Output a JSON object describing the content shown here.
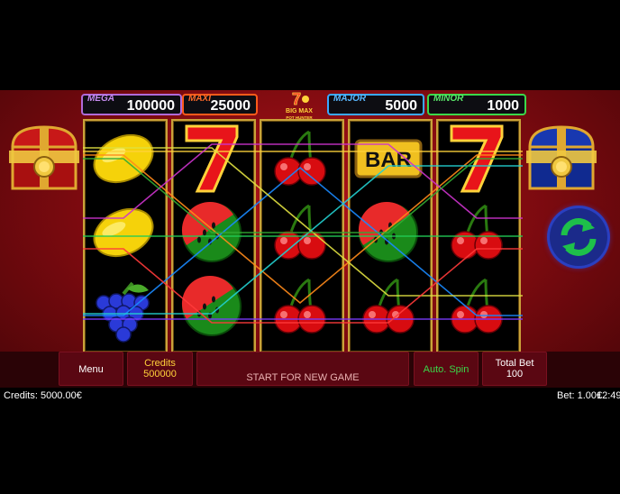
{
  "jackpots": {
    "mega": {
      "label": "MEGA",
      "value": "100000"
    },
    "maxi": {
      "label": "MAXI",
      "value": "25000"
    },
    "major": {
      "label": "MAJOR",
      "value": "5000"
    },
    "minor": {
      "label": "MINOR",
      "value": "1000"
    }
  },
  "logo": {
    "line1": "BIG MAX",
    "line2": "POT HUNTER"
  },
  "reels": [
    [
      "lemon",
      "lemon",
      "grapes"
    ],
    [
      "seven",
      "watermelon",
      "watermelon"
    ],
    [
      "cherry",
      "cherry",
      "cherry"
    ],
    [
      "bar",
      "watermelon",
      "cherry"
    ],
    [
      "seven",
      "cherry",
      "cherry"
    ]
  ],
  "bar_symbol_text": "BAR",
  "paylines": [
    {
      "color": "#ffd23a"
    },
    {
      "color": "#22cc55"
    },
    {
      "color": "#7a3aff"
    },
    {
      "color": "#ff8a1a"
    },
    {
      "color": "#1a8aff"
    },
    {
      "color": "#e0e040"
    },
    {
      "color": "#22d0d0"
    },
    {
      "color": "#cc33cc"
    },
    {
      "color": "#ff3a3a"
    },
    {
      "color": "#33aa33"
    }
  ],
  "controls": {
    "menu": "Menu",
    "credits_label": "Credits",
    "credits_value": "500000",
    "message": "START FOR NEW GAME",
    "auto_spin": "Auto. Spin",
    "total_bet_label": "Total Bet",
    "total_bet_value": "100"
  },
  "status": {
    "credits": "Credits: 5000.00€",
    "bet": "Bet: 1.00€",
    "time": "12:49"
  },
  "colors": {
    "background": "#8a0c12",
    "reel_frame": "#c9a23a",
    "button": "#5a0712",
    "auto_spin_text": "#3ad84a",
    "message_text": "#e8b0b0",
    "chest_left": "#c81818",
    "chest_right": "#1838b0",
    "spin_arrows": "#1ec04a"
  }
}
